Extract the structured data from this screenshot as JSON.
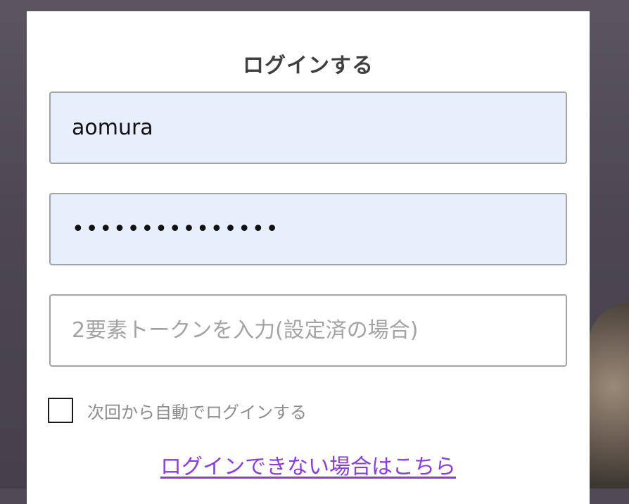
{
  "modal": {
    "title": "ログインする",
    "username": {
      "value": "aomura"
    },
    "password": {
      "value": "•••••••••••••••"
    },
    "token": {
      "placeholder": "2要素トークンを入力(設定済の場合)"
    },
    "remember_label": "次回から自動でログインする",
    "help_link": "ログインできない場合はこちら"
  },
  "colors": {
    "autofill_bg": "#e8effc",
    "link": "#8b3be0",
    "overlay": "#4f4a55"
  }
}
